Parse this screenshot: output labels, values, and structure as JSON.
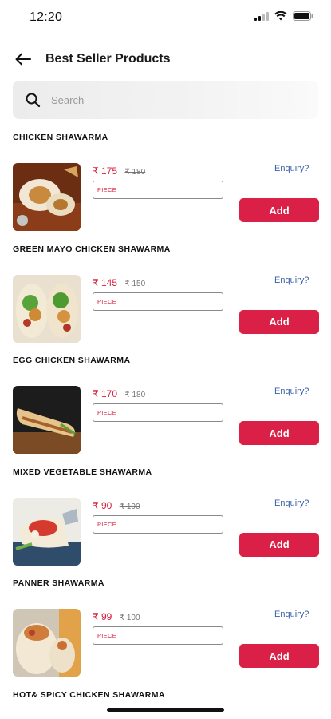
{
  "status_bar": {
    "time": "12:20"
  },
  "header": {
    "title": "Best Seller Products"
  },
  "search": {
    "placeholder": "Search"
  },
  "products": [
    {
      "name": "CHICKEN SHAWARMA",
      "currency": "₹",
      "price": "175",
      "mrp": "₹ 180",
      "unit": "PIECE",
      "enquiry": "Enquiry?",
      "add": "Add"
    },
    {
      "name": "GREEN MAYO CHICKEN SHAWARMA",
      "currency": "₹",
      "price": "145",
      "mrp": "₹ 150",
      "unit": "PIECE",
      "enquiry": "Enquiry?",
      "add": "Add"
    },
    {
      "name": "EGG CHICKEN SHAWARMA",
      "currency": "₹",
      "price": "170",
      "mrp": "₹ 180",
      "unit": "PIECE",
      "enquiry": "Enquiry?",
      "add": "Add"
    },
    {
      "name": "MIXED VEGETABLE SHAWARMA",
      "currency": "₹",
      "price": "90",
      "mrp": "₹ 100",
      "unit": "PIECE",
      "enquiry": "Enquiry?",
      "add": "Add"
    },
    {
      "name": "PANNER SHAWARMA",
      "currency": "₹",
      "price": "99",
      "mrp": "₹ 100",
      "unit": "PIECE",
      "enquiry": "Enquiry?",
      "add": "Add"
    }
  ],
  "next_product": {
    "name": "HOT& SPICY CHICKEN SHAWARMA"
  },
  "colors": {
    "accent": "#da2046",
    "price": "#d6213f",
    "link": "#3a5fa8"
  }
}
